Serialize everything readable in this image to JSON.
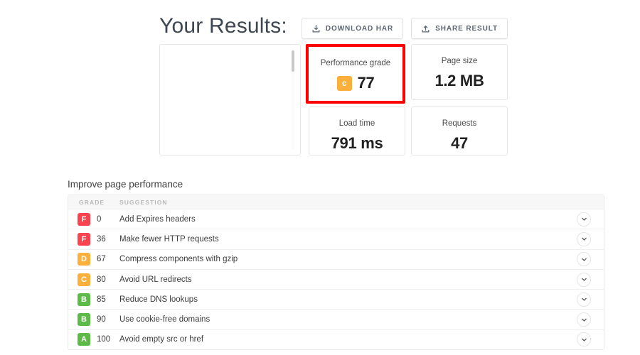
{
  "header": {
    "title": "Your Results:",
    "buttons": [
      {
        "label": "DOWNLOAD HAR",
        "icon": "download-icon"
      },
      {
        "label": "SHARE RESULT",
        "icon": "share-icon"
      }
    ]
  },
  "summary": {
    "waterfall_panel": {
      "has_scrollbar": true
    },
    "cards": [
      {
        "key": "performance_grade",
        "label": "Performance grade",
        "value": "77",
        "badge": {
          "letter": "c",
          "color": "#fcb03c"
        },
        "highlighted": true,
        "highlight_color": "#ff0000"
      },
      {
        "key": "page_size",
        "label": "Page size",
        "value": "1.2 MB",
        "highlighted": false
      },
      {
        "key": "load_time",
        "label": "Load time",
        "value": "791 ms",
        "highlighted": false
      },
      {
        "key": "requests",
        "label": "Requests",
        "value": "47",
        "highlighted": false
      }
    ]
  },
  "improve": {
    "section_title": "Improve page performance",
    "columns": {
      "grade": "GRADE",
      "suggestion": "SUGGESTION"
    },
    "toggle_icon": "chevron-down-icon",
    "grade_colors": {
      "A": "#5cbb46",
      "B": "#5cbb46",
      "C": "#fcb03c",
      "D": "#fcb03c",
      "F": "#f9434f"
    },
    "rows": [
      {
        "grade": "F",
        "color": "#f9434f",
        "score": "0",
        "suggestion": "Add Expires headers"
      },
      {
        "grade": "F",
        "color": "#f9434f",
        "score": "36",
        "suggestion": "Make fewer HTTP requests"
      },
      {
        "grade": "D",
        "color": "#fcb03c",
        "score": "67",
        "suggestion": "Compress components with gzip"
      },
      {
        "grade": "C",
        "color": "#fcb03c",
        "score": "80",
        "suggestion": "Avoid URL redirects"
      },
      {
        "grade": "B",
        "color": "#5cbb46",
        "score": "85",
        "suggestion": "Reduce DNS lookups"
      },
      {
        "grade": "B",
        "color": "#5cbb46",
        "score": "90",
        "suggestion": "Use cookie-free domains"
      },
      {
        "grade": "A",
        "color": "#5cbb46",
        "score": "100",
        "suggestion": "Avoid empty src or href"
      }
    ]
  }
}
